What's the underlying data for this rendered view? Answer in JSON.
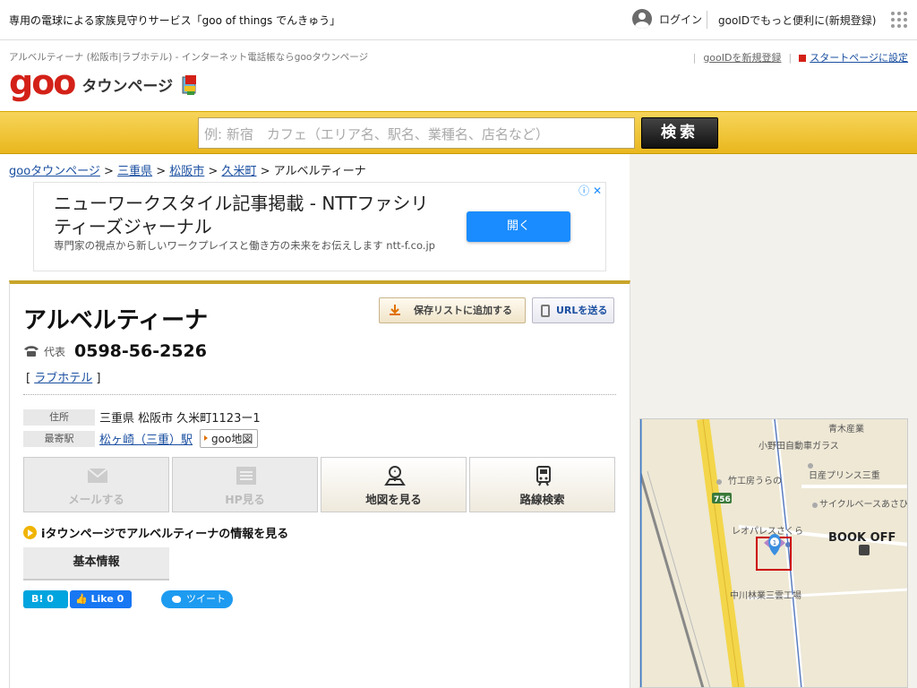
{
  "topbar": {
    "promo": "専用の電球による家族見守りサービス「goo of things でんきゅう」",
    "login": "ログイン",
    "register": "gooIDでもっと便利に(新規登録)"
  },
  "header": {
    "subtitle": "アルベルティーナ (松阪市|ラブホテル) - インターネット電話帳ならgooタウンページ",
    "logo_goo": "goo",
    "logo_text": "タウンページ",
    "links": {
      "new_id": "gooIDを新規登録",
      "startpage": "スタートページに設定"
    }
  },
  "search": {
    "placeholder": "例: 新宿　カフェ（エリア名、駅名、業種名、店名など）",
    "button": "検索"
  },
  "breadcrumb": {
    "items": [
      "gooタウンページ",
      "三重県",
      "松阪市",
      "久米町"
    ],
    "sep": " > ",
    "current": "アルベルティーナ"
  },
  "ad": {
    "title": "ニューワークスタイル記事掲載 - NTTファシリティーズジャーナル",
    "description": "専門家の視点から新しいワークプレイスと働き方の未来をお伝えします ntt-f.co.jp",
    "button": "開く"
  },
  "listing": {
    "name": "アルベルティーナ",
    "save_button": "保存リストに追加する",
    "url_button": "URLを送る",
    "phone_label": "代表",
    "phone": "0598-56-2526",
    "category": "ラブホテル",
    "address_label": "住所",
    "address": "三重県 松阪市 久米町1123ー1",
    "station_label": "最寄駅",
    "station": "松ヶ崎（三重）駅",
    "goo_map": "goo地図",
    "actions": [
      {
        "label": "メールする",
        "enabled": false
      },
      {
        "label": "HP見る",
        "enabled": false
      },
      {
        "label": "地図を見る",
        "enabled": true
      },
      {
        "label": "路線検索",
        "enabled": true
      }
    ],
    "itown_link": "iタウンページでアルベルティーナの情報を見る",
    "tab_basic": "基本情報"
  },
  "social": {
    "hatena_count": "0",
    "fb_like": "Like",
    "fb_count": "0",
    "tweet": "ツイート"
  },
  "map": {
    "labels": [
      "青木産業",
      "小野田自動車ガラス",
      "竹工房うらの",
      "日産プリンス三重",
      "サイクルベースあさひ",
      "レオパレスさくら",
      "BOOK OFF",
      "中川林業三雲工場"
    ],
    "route": "756",
    "marker": "1"
  }
}
